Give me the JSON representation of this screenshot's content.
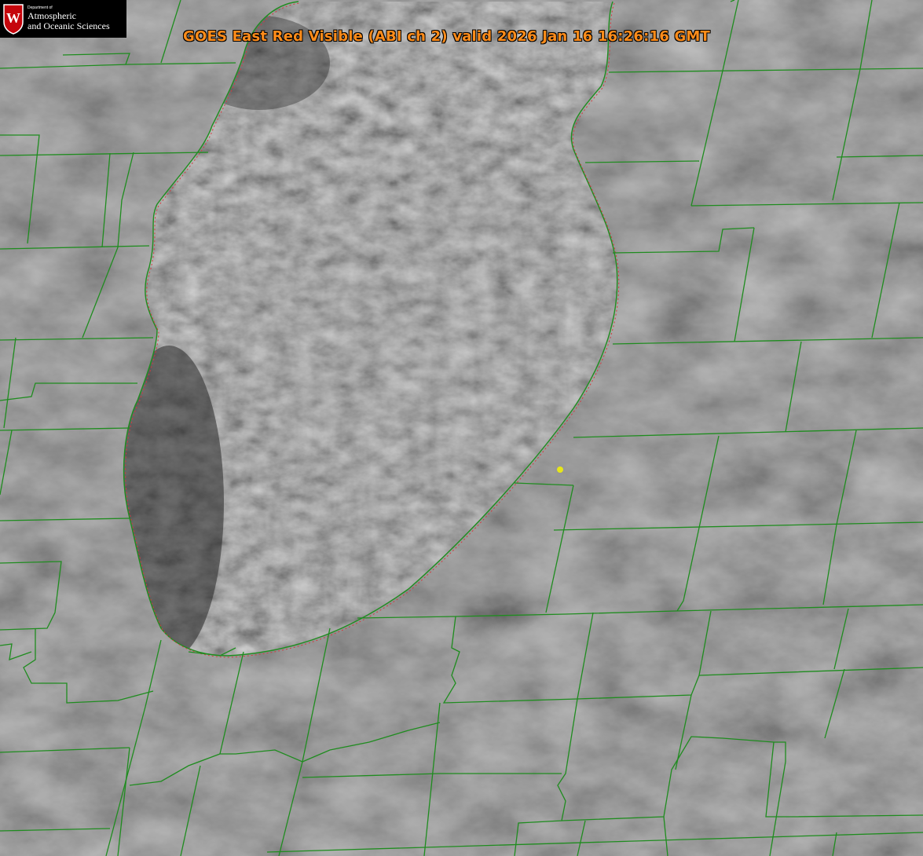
{
  "title": "GOES East Red Visible (ABI ch 2) valid 2026 Jan 16 16:26:16 GMT",
  "logo": {
    "department": "Department of",
    "line1": "Atmospheric",
    "line2": "and Oceanic Sciences",
    "seal_letter": "W"
  },
  "colors": {
    "title": "#ff8c1a",
    "county_lines": "#1f8c1f",
    "shoreline_dotted": "#d23c3c",
    "marker": "#e6e619",
    "logo_crest": "#c5050c"
  },
  "marker": {
    "icon": "location-dot-icon"
  }
}
